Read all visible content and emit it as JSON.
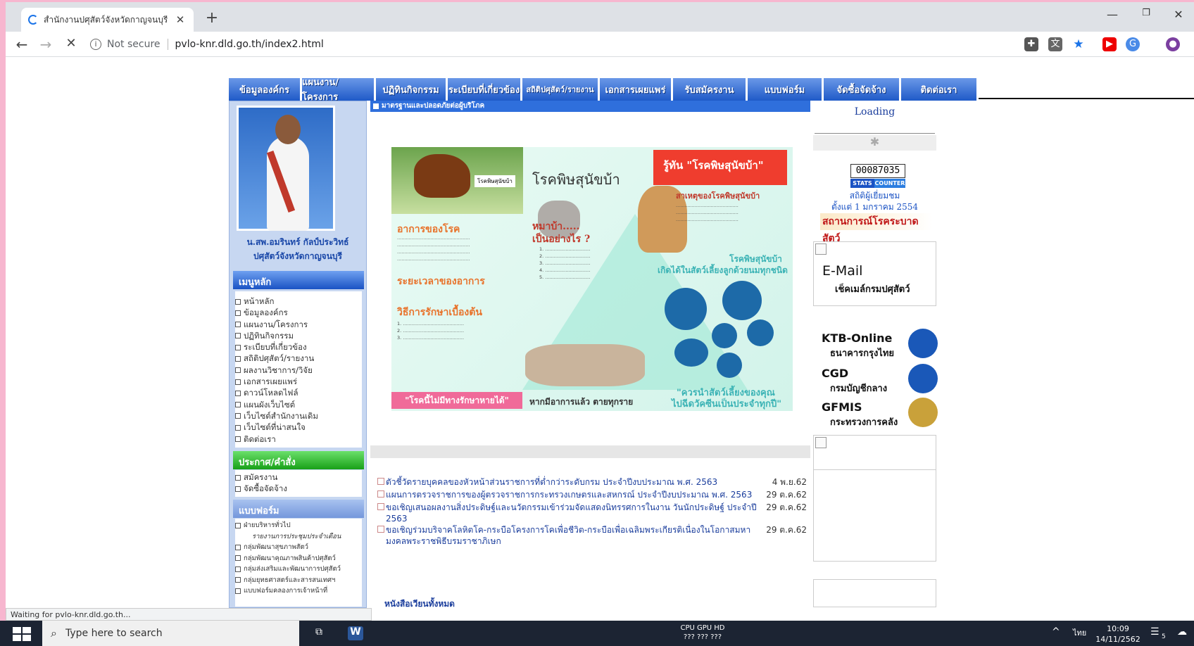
{
  "browser": {
    "tab_title": "สำนักงานปศุสัตว์จังหวัดกาญจนบุรี",
    "tab_close": "✕",
    "new_tab": "+",
    "window_controls": {
      "minimize": "—",
      "restore": "❐",
      "close": "✕"
    },
    "security_label": "Not secure",
    "url": "pvlo-knr.dld.go.th/index2.html"
  },
  "site": {
    "top_nav": [
      "ข้อมูลองค์กร",
      "แผนงาน/โครงการ",
      "ปฏิทินกิจกรรม",
      "ระเบียบที่เกี่ยวข้อง",
      "สถิติปศุสัตว์/รายงาน",
      "เอกสารเผยแพร่",
      "รับสมัครงาน",
      "แบบฟอร์ม",
      "จัดซื้อจัดจ้าง",
      "ติดต่อเรา"
    ],
    "left": {
      "caption_line1": "น.สพ.อมรินทร์ กัลป์ประวิทธ์",
      "caption_line2": "ปศุสัตว์จังหวัดกาญจนบุรี",
      "main_menu_title": "เมนูหลัก",
      "main_menu": [
        "หน้าหลัก",
        "ข้อมูลองค์กร",
        "แผนงาน/โครงการ",
        "ปฏิทินกิจกรรม",
        "ระเบียบที่เกี่ยวข้อง",
        "สถิติปศุสัตว์/รายงาน",
        "ผลงานวิชาการ/วิจัย",
        "เอกสารเผยแพร่",
        "ดาวน์โหลดไฟล์",
        "แผนผังเว็บไซต์",
        "เว็บไซต์สำนักงานเดิม",
        "เว็บไซต์ที่น่าสนใจ",
        "ติดต่อเรา"
      ],
      "announce_title": "ประกาศ/คำสั่ง",
      "announce_menu": [
        "สมัครงาน",
        "จัดซื้อจัดจ้าง"
      ],
      "forms_title": "แบบฟอร์ม",
      "forms_menu": [
        "ฝ่ายบริหารทั่วไป",
        "รายงานการประชุมประจำเดือน",
        "กลุ่มพัฒนาสุขภาพสัตว์",
        "กลุ่มพัฒนาคุณภาพสินค้าปศุสัตว์",
        "กลุ่มส่งเสริมและพัฒนาการปศุสัตว์",
        "กลุ่มยุทธศาสตร์และสารสนเทศฯ",
        "แบบฟอร์มคลองการเจ้าหน้าที่"
      ]
    },
    "center": {
      "banner_title": "มาตรฐานและปลอดภัยต่อผู้บริโภค",
      "poster": {
        "tag": "โรคพิษสุนัขบ้า",
        "title": "โรคพิษสุนัขบ้า",
        "red_box": "รู้ทัน \"โรคพิษสุนัขบ้า\"",
        "cause": "สาเหตุของโรคพิษสุนัขบ้า",
        "symptoms": "อาการของโรค",
        "duration": "ระยะเวลาของอาการ",
        "first_aid": "วิธีการรักษาเบื้องต้น",
        "bitten": "หมาบ้า.....",
        "what": "เป็นอย่างไร ?",
        "occurs": "โรคพิษสุนัขบ้า",
        "occurs2": "เกิดได้ในสัตว์เลี้ยงลูกด้วยนมทุกชนิด",
        "no_cure": "\"โรคนี้ไม่มีทางรักษาหายได้\"",
        "once_sick": "หากมีอาการแล้ว ตายทุกราย",
        "vaccinate": "\"ควรนำสัตว์เลี้ยงของคุณ",
        "vaccinate2": "ไปฉีดวัคซีนเป็นประจำทุกปี\"",
        "pets": [
          "สุนัข",
          "แมว",
          "",
          "",
          "",
          ""
        ]
      },
      "news": [
        {
          "text": "ตัวชี้วัดรายบุคคลของหัวหน้าส่วนราชการที่ต่ำกว่าระดับกรม ประจำปีงบประมาณ พ.ศ. 2563",
          "date": "4 พ.ย.62"
        },
        {
          "text": "แผนการตรวจราชการของผู้ตรวจราชการกระทรวงเกษตรและสหกรณ์ ประจำปีงบประมาณ พ.ศ. 2563",
          "date": "29 ต.ค.62"
        },
        {
          "text": "ขอเชิญเสนอผลงานสิ่งประดิษฐ์และนวัตกรรมเข้าร่วมจัดแสดงนิทรรศการในงาน วันนักประดิษฐ์ ประจำปี 2563",
          "date": "29 ต.ค.62"
        },
        {
          "text": "ขอเชิญร่วมบริจาคโลหิตโค-กระบือโครงการโคเพื่อชีวิต-กระบือเพื่อเฉลิมพระเกียรติเนื่องในโอกาสมหามงคลพระราชพิธีบรมราชาภิเษก",
          "date": "29 ต.ค.62"
        }
      ],
      "all_letters": "หนังสือเวียนทั้งหมด"
    },
    "right": {
      "loading": "Loading",
      "counter_value": "00087035",
      "counter_stats": "STATS",
      "counter_counter": "COUNTER",
      "visitors": "สถิติผู้เยี่ยมชม",
      "since": "ตั้งแต่ 1 มกราคม 2554",
      "disease": "สถานการณ์โรคระบาดสัตว์",
      "email": "E-Mail",
      "email_sub": "เช็คเมล์กรมปศุสัตว์",
      "ktb": "KTB-Online",
      "ktb_sub": "ธนาคารกรุงไทย",
      "cgd": "CGD",
      "cgd_sub": "กรมบัญชีกลาง",
      "gfmis": "GFMIS",
      "gfmis_sub": "กระทรวงการคลัง"
    }
  },
  "status_text": "Waiting for pvlo-knr.dld.go.th...",
  "taskbar": {
    "search_placeholder": "Type here to search",
    "cpu_line1": "CPU GPU HD",
    "cpu_line2": "???  ???  ???",
    "lang": "ไทย",
    "time": "10:09",
    "date": "14/11/2562",
    "notif_count": "5"
  }
}
